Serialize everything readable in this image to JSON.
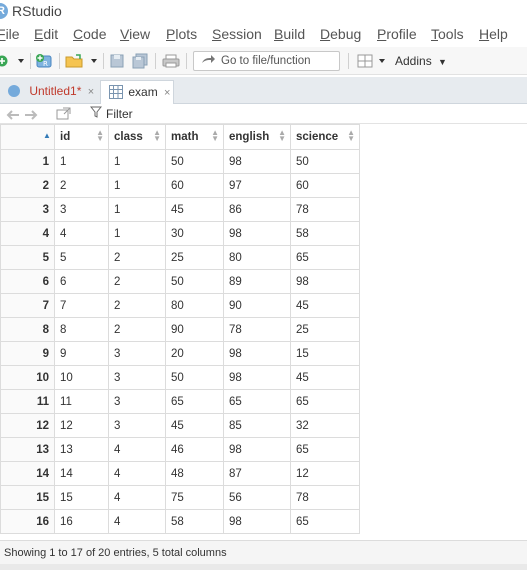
{
  "window": {
    "title": "RStudio"
  },
  "menu": [
    {
      "label": "File",
      "key": "F",
      "rest": "ile"
    },
    {
      "label": "Edit",
      "key": "E",
      "rest": "dit"
    },
    {
      "label": "Code",
      "key": "C",
      "rest": "ode"
    },
    {
      "label": "View",
      "key": "V",
      "rest": "iew"
    },
    {
      "label": "Plots",
      "key": "P",
      "rest": "lots"
    },
    {
      "label": "Session",
      "key": "S",
      "rest": "ession"
    },
    {
      "label": "Build",
      "key": "B",
      "rest": "uild"
    },
    {
      "label": "Debug",
      "key": "D",
      "rest": "ebug"
    },
    {
      "label": "Profile",
      "key": "P",
      "rest": "rofile"
    },
    {
      "label": "Tools",
      "key": "T",
      "rest": "ools"
    },
    {
      "label": "Help",
      "key": "H",
      "rest": "elp"
    }
  ],
  "toolbar": {
    "goto_placeholder": "Go to file/function",
    "addins_label": "Addins"
  },
  "tabs": {
    "untitled": {
      "label": "Untitled1*",
      "close": "×"
    },
    "exam": {
      "label": "exam",
      "close": "×"
    }
  },
  "viewer": {
    "filter_label": "Filter"
  },
  "table": {
    "columns": [
      "id",
      "class",
      "math",
      "english",
      "science"
    ],
    "rows": [
      {
        "n": "1",
        "cells": [
          "1",
          "1",
          "50",
          "98",
          "50"
        ]
      },
      {
        "n": "2",
        "cells": [
          "2",
          "1",
          "60",
          "97",
          "60"
        ]
      },
      {
        "n": "3",
        "cells": [
          "3",
          "1",
          "45",
          "86",
          "78"
        ]
      },
      {
        "n": "4",
        "cells": [
          "4",
          "1",
          "30",
          "98",
          "58"
        ]
      },
      {
        "n": "5",
        "cells": [
          "5",
          "2",
          "25",
          "80",
          "65"
        ]
      },
      {
        "n": "6",
        "cells": [
          "6",
          "2",
          "50",
          "89",
          "98"
        ]
      },
      {
        "n": "7",
        "cells": [
          "7",
          "2",
          "80",
          "90",
          "45"
        ]
      },
      {
        "n": "8",
        "cells": [
          "8",
          "2",
          "90",
          "78",
          "25"
        ]
      },
      {
        "n": "9",
        "cells": [
          "9",
          "3",
          "20",
          "98",
          "15"
        ]
      },
      {
        "n": "10",
        "cells": [
          "10",
          "3",
          "50",
          "98",
          "45"
        ]
      },
      {
        "n": "11",
        "cells": [
          "11",
          "3",
          "65",
          "65",
          "65"
        ]
      },
      {
        "n": "12",
        "cells": [
          "12",
          "3",
          "45",
          "85",
          "32"
        ]
      },
      {
        "n": "13",
        "cells": [
          "13",
          "4",
          "46",
          "98",
          "65"
        ]
      },
      {
        "n": "14",
        "cells": [
          "14",
          "4",
          "48",
          "87",
          "12"
        ]
      },
      {
        "n": "15",
        "cells": [
          "15",
          "4",
          "75",
          "56",
          "78"
        ]
      },
      {
        "n": "16",
        "cells": [
          "16",
          "4",
          "58",
          "98",
          "65"
        ]
      }
    ]
  },
  "status": {
    "text": "Showing 1 to 17 of 20 entries, 5 total columns"
  },
  "colors": {
    "accent": "#337ab7",
    "unsaved_tab": "#c0392b"
  }
}
